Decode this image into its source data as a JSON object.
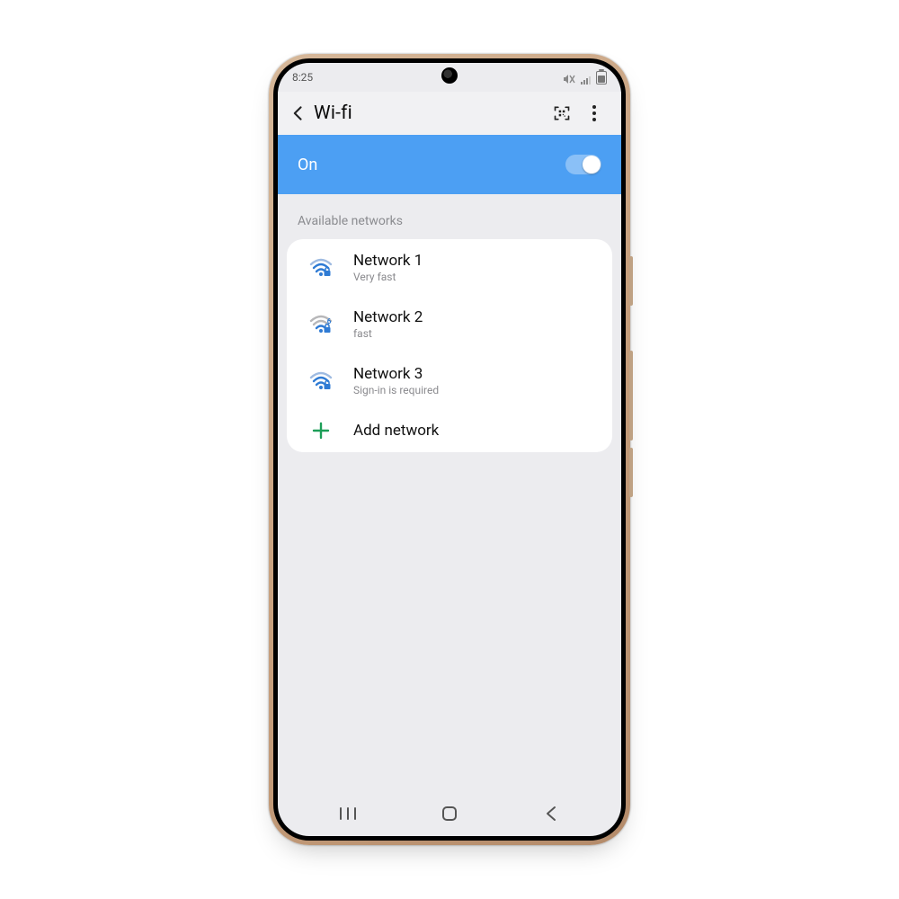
{
  "statusbar": {
    "time": "8:25"
  },
  "appbar": {
    "title": "Wi-fi"
  },
  "toggle": {
    "label": "On",
    "state": "on"
  },
  "section": {
    "header": "Available networks"
  },
  "networks": [
    {
      "name": "Network 1",
      "sub": "Very fast",
      "variant": "full"
    },
    {
      "name": "Network 2",
      "sub": "fast",
      "variant": "wifi6"
    },
    {
      "name": "Network 3",
      "sub": "Sign-in is required",
      "variant": "full"
    }
  ],
  "add_network": {
    "label": "Add network"
  }
}
